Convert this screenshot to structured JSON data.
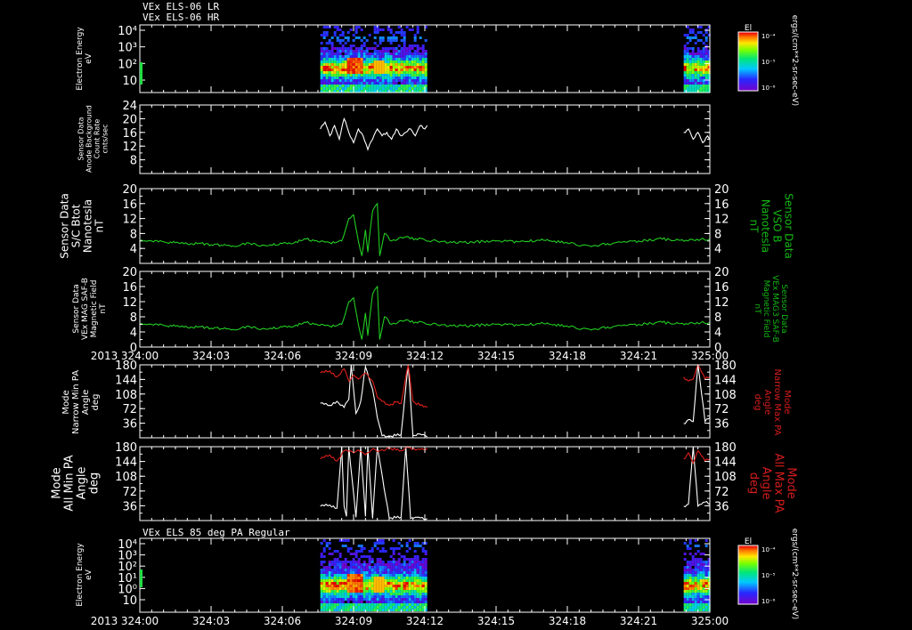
{
  "header": {
    "line1": "VEx ELS-06 LR",
    "line2": "VEx ELS-06 HR"
  },
  "spec_bottom_title": "VEx ELS 85 deg PA Regular",
  "cbar_unit": "ergs/(cm**2-sr-sec-eV)",
  "colors": {
    "white": "#ffffff",
    "green": "#22cc22",
    "red": "#e0201a",
    "ylabel_green": "#14b814",
    "ylabel_red": "#d41c1c"
  },
  "chart_data": [
    {
      "type": "heatmap",
      "ylabel": [
        "Electron Energy",
        "eV"
      ],
      "y_ticks": [
        "10⁴",
        "10³",
        "10²",
        "10"
      ],
      "colorbar": {
        "label": "El",
        "ticks": [
          "10⁻⁴",
          "10⁻⁵",
          "10⁻⁶"
        ]
      },
      "coverage_hours": [
        [
          7.6,
          12.1
        ],
        [
          22.9,
          24.0
        ]
      ]
    },
    {
      "type": "line",
      "ylabel": [
        "Sensor Data",
        "Anode Background",
        "Count Rate",
        "cnts/sec"
      ],
      "y_ticks": [
        "24",
        "20",
        "16",
        "12",
        "8"
      ],
      "ylim": [
        4,
        24
      ],
      "series": [
        {
          "color": "white",
          "x": [
            7.6,
            7.8,
            8.0,
            8.2,
            8.4,
            8.6,
            8.8,
            9.0,
            9.2,
            9.4,
            9.6,
            9.8,
            10.0,
            10.2,
            10.4,
            10.6,
            10.8,
            11.0,
            11.2,
            11.4,
            11.6,
            11.8,
            12.0,
            12.1,
            22.9,
            23.1,
            23.3,
            23.5,
            23.7,
            23.9,
            24.0
          ],
          "y": [
            17,
            19,
            15,
            18,
            14,
            20,
            16,
            13,
            17,
            15,
            11,
            14,
            17,
            15,
            16,
            14,
            17,
            15,
            16,
            17,
            15,
            18,
            17,
            18,
            16,
            17,
            14,
            16,
            13,
            15,
            14
          ]
        }
      ]
    },
    {
      "type": "line",
      "ylabel": [
        "Sensor Data",
        "S/C Btot",
        "Nanotesla",
        "nT"
      ],
      "ylabel_right": [
        "Sensor Data",
        "VSO B",
        "Nanotesla",
        "nT"
      ],
      "y_ticks": [
        "20",
        "16",
        "12",
        "8",
        "4"
      ],
      "ylim": [
        0,
        20
      ],
      "series": [
        {
          "color": "green",
          "x": [
            0,
            0.5,
            1,
            1.5,
            2,
            2.5,
            3,
            3.5,
            4,
            4.5,
            5,
            5.5,
            6,
            6.5,
            7,
            7.5,
            8,
            8.5,
            8.8,
            9.0,
            9.2,
            9.35,
            9.5,
            9.6,
            9.8,
            10.0,
            10.1,
            10.3,
            10.6,
            11,
            12,
            13,
            14,
            15,
            16,
            17,
            18,
            19,
            20,
            21,
            22,
            23,
            24
          ],
          "y": [
            6,
            6,
            5.8,
            5.5,
            5.2,
            5.4,
            5,
            4.8,
            4.5,
            5.5,
            4.7,
            5,
            5.3,
            5.5,
            6.5,
            5.8,
            5.5,
            6,
            12,
            13,
            6,
            2,
            9,
            3,
            14,
            16,
            2,
            8,
            6,
            7,
            6.3,
            5.5,
            5.7,
            6,
            5.8,
            6.2,
            5.5,
            4.5,
            5.5,
            6,
            6.5,
            6.2,
            6.5
          ]
        }
      ]
    },
    {
      "type": "line",
      "ylabel": [
        "Sensor Data",
        "VEx MAG SAF-B",
        "Magnetic Field",
        "nT"
      ],
      "ylabel_right": [
        "Sensor Data",
        "VEx MAG3 SAF-B",
        "Magnetic Field",
        "nT"
      ],
      "y_ticks": [
        "20",
        "16",
        "12",
        "8",
        "4",
        "0"
      ],
      "ylim": [
        0,
        20
      ],
      "series": [
        {
          "color": "green",
          "x": [
            0,
            0.5,
            1,
            1.5,
            2,
            2.5,
            3,
            3.5,
            4,
            4.5,
            5,
            5.5,
            6,
            6.5,
            7,
            7.5,
            8,
            8.5,
            8.8,
            9.0,
            9.2,
            9.35,
            9.5,
            9.6,
            9.8,
            10.0,
            10.1,
            10.3,
            10.6,
            11,
            12,
            13,
            14,
            15,
            16,
            17,
            18,
            19,
            20,
            21,
            22,
            23,
            24
          ],
          "y": [
            6,
            6,
            5.8,
            5.5,
            5.2,
            5.4,
            5,
            4.8,
            4.5,
            5.5,
            4.7,
            5,
            5.3,
            5.5,
            6.5,
            5.8,
            5.5,
            6,
            12,
            13,
            6,
            2,
            9,
            3,
            14,
            16,
            2,
            8,
            6,
            7,
            6.3,
            5.5,
            5.7,
            6,
            5.8,
            6.2,
            5.5,
            4.5,
            5.5,
            6,
            6.5,
            6.2,
            6.5
          ]
        }
      ]
    },
    {
      "type": "line",
      "ylabel": [
        "Mode",
        "Narrow Min PA",
        "Angle",
        "deg"
      ],
      "ylabel_right": [
        "Mode",
        "Narrow Max PA",
        "Angle",
        "deg"
      ],
      "y_ticks": [
        "180",
        "144",
        "108",
        "72",
        "36"
      ],
      "ylim": [
        0,
        180
      ],
      "series": [
        {
          "color": "white",
          "x": [
            7.6,
            8.0,
            8.3,
            8.6,
            8.8,
            8.9,
            9.1,
            9.3,
            9.5,
            9.8,
            10.0,
            10.2,
            10.5,
            11.0,
            11.3,
            11.5,
            11.7,
            12.1,
            22.9,
            23.1,
            23.3,
            23.5,
            23.8,
            24.0
          ],
          "y": [
            85,
            80,
            90,
            75,
            95,
            180,
            60,
            90,
            175,
            120,
            50,
            5,
            3,
            8,
            180,
            5,
            10,
            2,
            35,
            45,
            40,
            180,
            40,
            50
          ]
        },
        {
          "color": "red",
          "x": [
            7.6,
            8.0,
            8.3,
            8.6,
            8.8,
            9.0,
            9.2,
            9.5,
            9.8,
            10.0,
            10.2,
            10.5,
            10.8,
            11.0,
            11.3,
            11.5,
            11.8,
            12.1,
            22.9,
            23.1,
            23.3,
            23.5,
            23.8,
            24.0
          ],
          "y": [
            160,
            165,
            150,
            170,
            140,
            155,
            145,
            160,
            140,
            100,
            90,
            80,
            88,
            85,
            180,
            90,
            80,
            75,
            150,
            140,
            145,
            180,
            145,
            150
          ]
        }
      ]
    },
    {
      "type": "line",
      "ylabel": [
        "Mode",
        "All Min PA",
        "Angle",
        "deg"
      ],
      "ylabel_right": [
        "Mode",
        "All Max PA",
        "Angle",
        "deg"
      ],
      "y_ticks": [
        "180",
        "144",
        "108",
        "72",
        "36"
      ],
      "ylim": [
        0,
        180
      ],
      "series": [
        {
          "color": "white",
          "x": [
            7.6,
            8.0,
            8.3,
            8.5,
            8.6,
            8.7,
            8.8,
            9.1,
            9.3,
            9.5,
            9.6,
            9.8,
            10.0,
            10.5,
            11.0,
            11.2,
            11.4,
            11.6,
            12.1,
            22.9,
            23.1,
            23.3,
            23.5,
            23.8,
            24.0
          ],
          "y": [
            35,
            38,
            30,
            180,
            35,
            10,
            180,
            8,
            180,
            10,
            180,
            5,
            180,
            6,
            8,
            180,
            5,
            8,
            5,
            35,
            40,
            180,
            35,
            45,
            40
          ]
        },
        {
          "color": "red",
          "x": [
            7.6,
            8.0,
            8.3,
            8.6,
            9.0,
            9.2,
            9.5,
            9.8,
            10.0,
            10.5,
            11.0,
            11.3,
            11.6,
            12.1,
            22.9,
            23.1,
            23.3,
            23.5,
            23.8,
            24.0
          ],
          "y": [
            150,
            160,
            145,
            170,
            165,
            172,
            160,
            175,
            168,
            176,
            170,
            178,
            172,
            176,
            150,
            165,
            140,
            170,
            145,
            150
          ]
        }
      ]
    },
    {
      "type": "heatmap",
      "ylabel": [
        "Electron Energy",
        "eV"
      ],
      "y_ticks": [
        "10⁴",
        "10³",
        "10²",
        "10¹",
        "10⁰",
        "10"
      ],
      "colorbar": {
        "label": "El",
        "ticks": [
          "10⁻⁴",
          "10⁻⁵",
          "10⁻⁶"
        ]
      },
      "coverage_hours": [
        [
          7.6,
          12.1
        ],
        [
          22.9,
          24.0
        ]
      ]
    }
  ],
  "x_axis": {
    "year": "2013",
    "ticks": [
      "324:00",
      "324:03",
      "324:06",
      "324:09",
      "324:12",
      "324:15",
      "324:18",
      "324:21",
      "325:00"
    ]
  }
}
